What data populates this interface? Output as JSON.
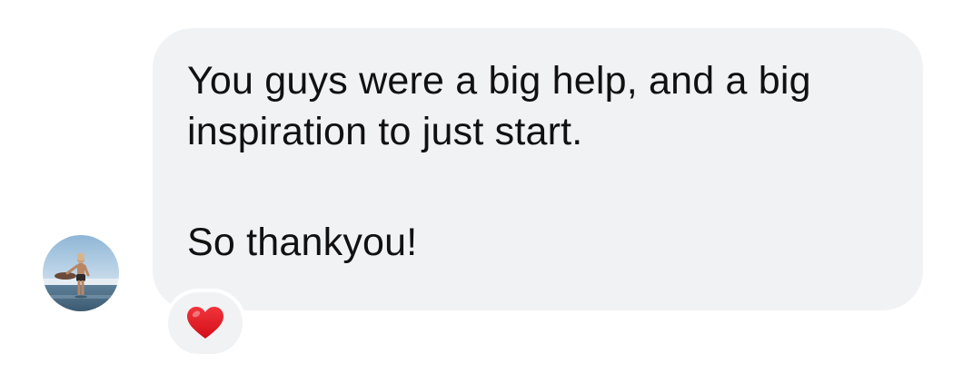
{
  "conversation": {
    "message": {
      "line1": "You guys were a big help, and a big inspiration to just start.",
      "line2": "So thankyou!"
    },
    "reaction": {
      "icon": "red-heart-icon",
      "color": "#e0141e"
    },
    "colors": {
      "bubble_background": "#f1f2f4",
      "text": "#111111",
      "page_background": "#ffffff"
    }
  }
}
